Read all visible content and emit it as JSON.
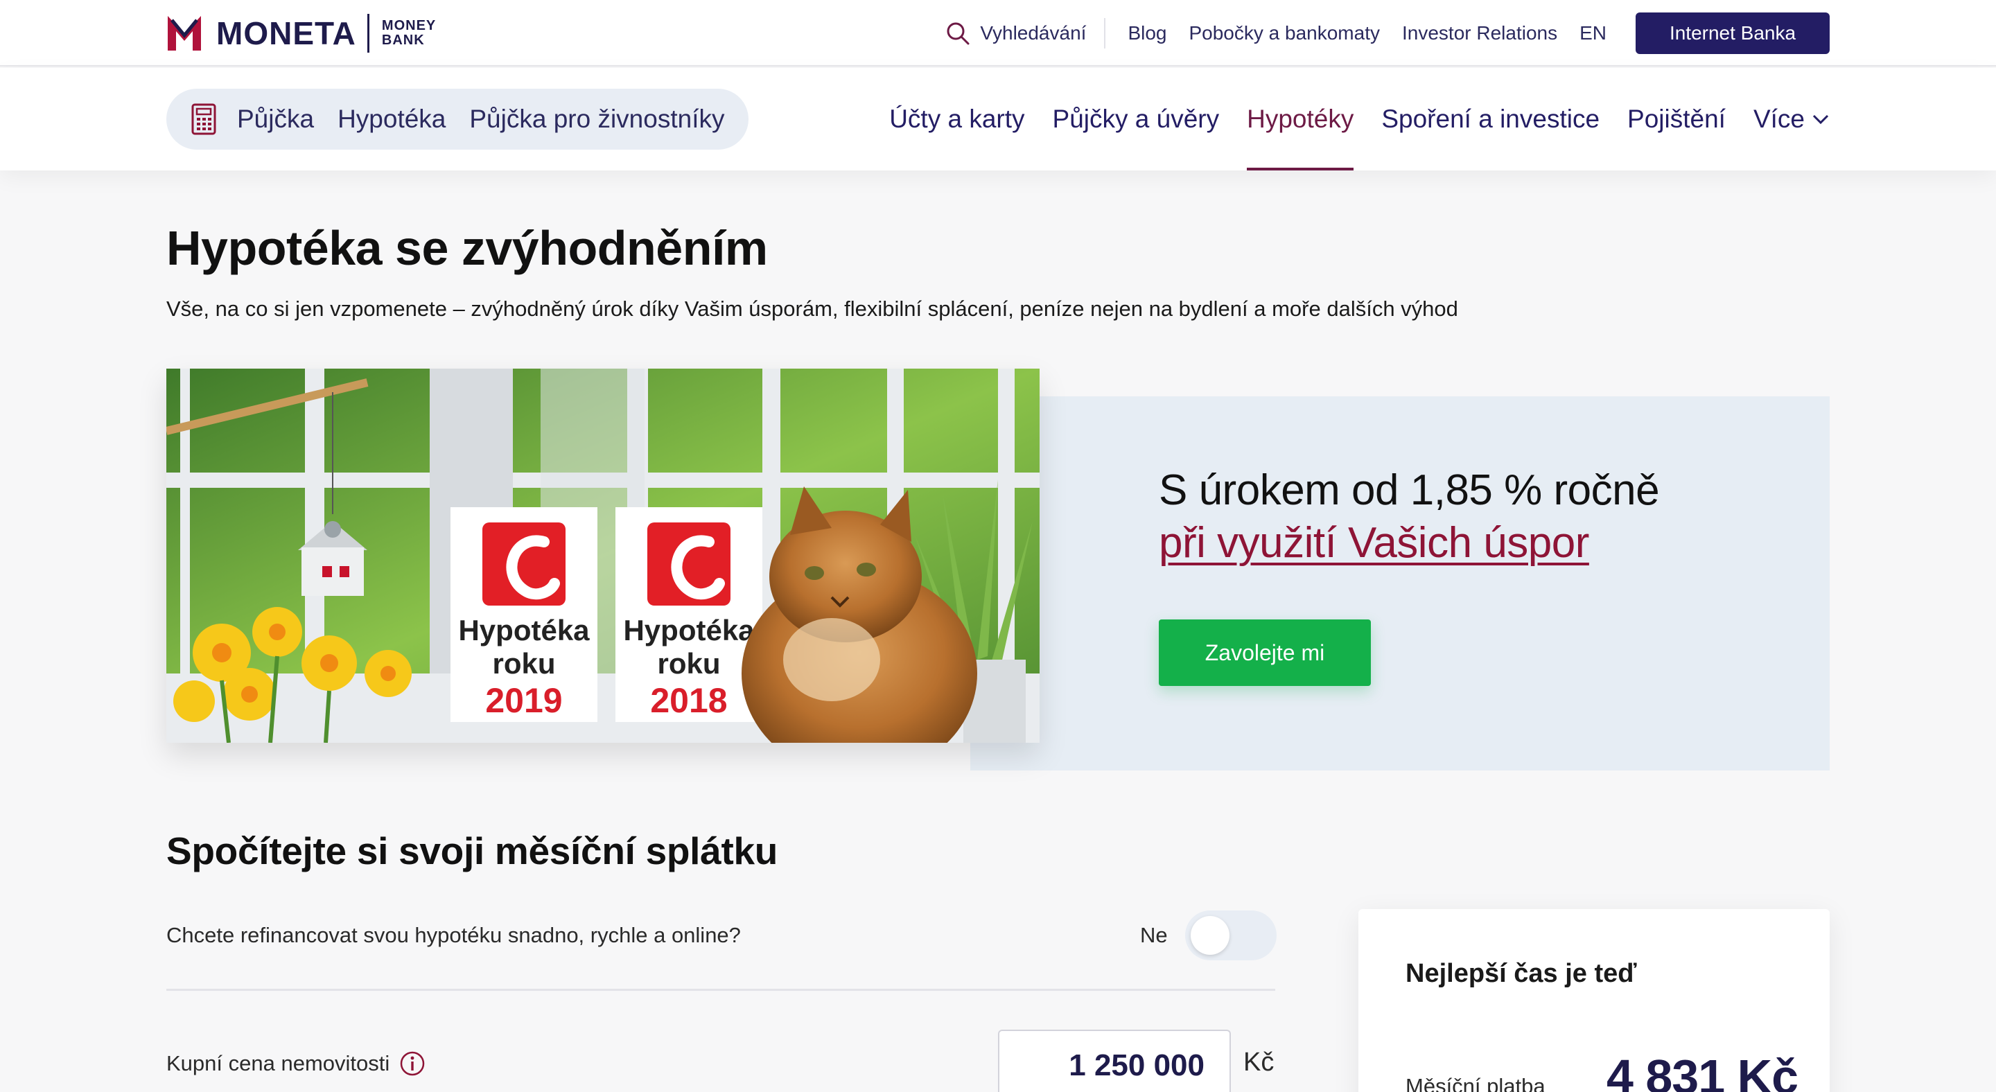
{
  "brand": {
    "name": "MONETA",
    "sub_line1": "MONEY",
    "sub_line2": "BANK",
    "color": "#231d64"
  },
  "topbar": {
    "search_label": "Vyhledávání",
    "links": [
      "Blog",
      "Pobočky a bankomaty",
      "Investor Relations",
      "EN"
    ],
    "internet_bank": "Internet Banka"
  },
  "quicklinks": [
    "Půjčka",
    "Hypotéka",
    "Půjčka pro živnostníky"
  ],
  "mainnav": {
    "items": [
      "Účty a karty",
      "Půjčky a úvěry",
      "Hypotéky",
      "Spoření a investice",
      "Pojištění",
      "Více"
    ],
    "active": "Hypotéky"
  },
  "hero": {
    "title": "Hypotéka se zvýhodněním",
    "lead": "Vše, na co si jen vzpomenete – zvýhodněný úrok díky Vašim úsporám, flexibilní splácení, peníze nejen na bydlení a moře dalších výhod"
  },
  "promo": {
    "rate_line": "S úrokem od 1,85 % ročně",
    "link_line": "při využití Vašich úspor",
    "call_button": "Zavolejte mi",
    "badges": [
      {
        "line1": "Hypotéka",
        "line2": "roku",
        "year": "2019"
      },
      {
        "line1": "Hypotéka",
        "line2": "roku",
        "year": "2018"
      }
    ],
    "accent_red": "#8e1436",
    "button_green": "#14b04a"
  },
  "calculator": {
    "title": "Spočítejte si svoji měsíční splátku",
    "refinance_question": "Chcete refinancovat svou hypotéku snadno, rychle a online?",
    "refinance_answer": "Ne",
    "price_label": "Kupní cena nemovitosti",
    "price_value": "1 250 000",
    "price_unit": "Kč"
  },
  "summary": {
    "title": "Nejlepší čas je teď",
    "monthly_label": "Měsíční platba",
    "monthly_value": "4 831 Kč"
  }
}
